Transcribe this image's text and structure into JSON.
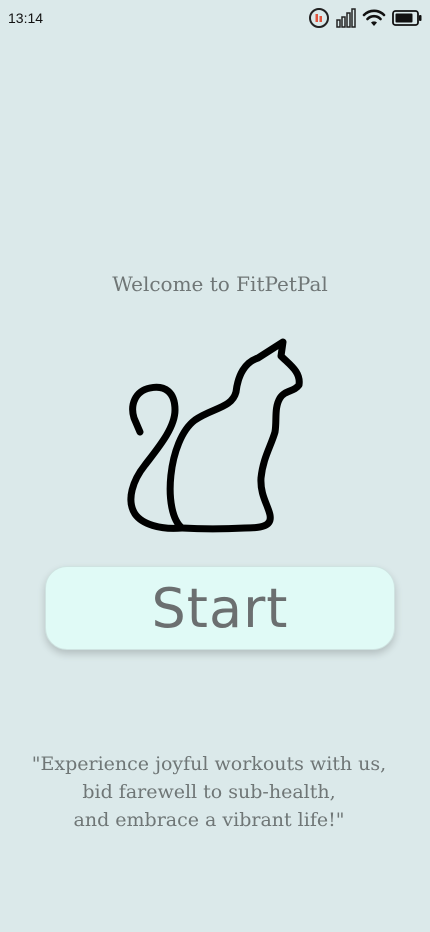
{
  "status_bar": {
    "time": "13:14",
    "icons": [
      "data-saver-icon",
      "cellular-signal-icon",
      "wifi-icon",
      "battery-icon"
    ]
  },
  "welcome": {
    "text": "Welcome to FitPetPal"
  },
  "logo": {
    "icon": "cat-silhouette-icon"
  },
  "start_button": {
    "label": "Start"
  },
  "quote": {
    "lines": [
      "\"Experience joyful workouts with us,",
      "bid farewell to sub-health,",
      "and embrace a vibrant life!\""
    ]
  },
  "colors": {
    "background": "#dbe9ea",
    "button_fill": "#e0faf6",
    "text": "#6f7676",
    "button_text": "#6b6f70",
    "logo_stroke": "#000000"
  }
}
